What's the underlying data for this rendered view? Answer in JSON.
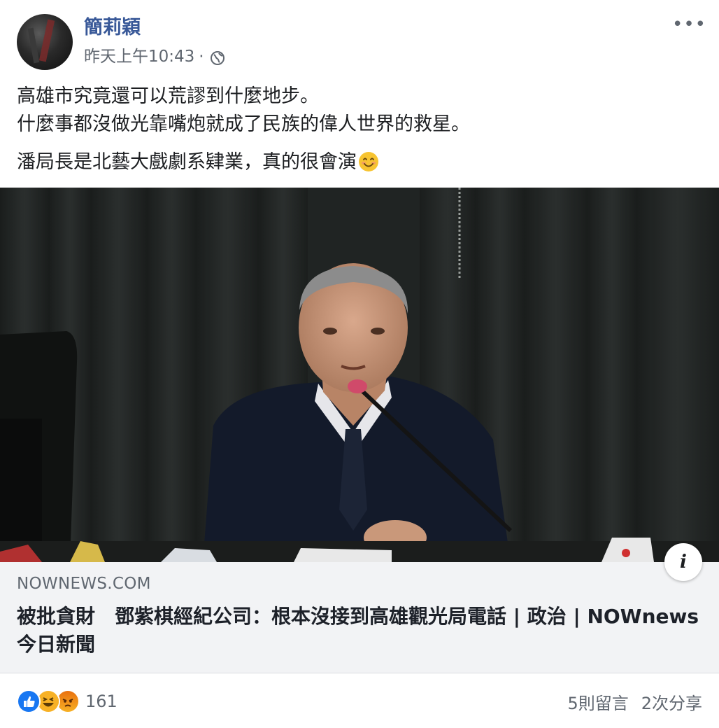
{
  "post": {
    "author": "簡莉穎",
    "timestamp": "昨天上午10:43",
    "separator": "·",
    "privacy_icon": "globe-icon",
    "more_label": "•••",
    "text_lines": [
      "高雄市究竟還可以荒謬到什麼地步。",
      "什麼事都沒做光靠嘴炮就成了民族的偉人世界的救星。",
      "潘局長是北藝大戲劇系肄業，真的很會演"
    ],
    "emoji": "smiling-face-emoji"
  },
  "link": {
    "domain": "NOWNEWS.COM",
    "title": "被批貪財　鄧紫棋經紀公司：根本沒接到高雄觀光局電話 | 政治 | NOWnews 今日新聞",
    "info_label": "i"
  },
  "footer": {
    "reaction_icons": [
      "like-icon",
      "haha-icon",
      "angry-icon"
    ],
    "reaction_count": "161",
    "comments": "5則留言",
    "shares": "2次分享"
  },
  "colors": {
    "author": "#385898",
    "secondary_text": "#606770",
    "link_bg": "#f2f3f5",
    "like": "#1877f2",
    "reaction_yellow": "#f7b125",
    "angry": "#e9710f"
  }
}
